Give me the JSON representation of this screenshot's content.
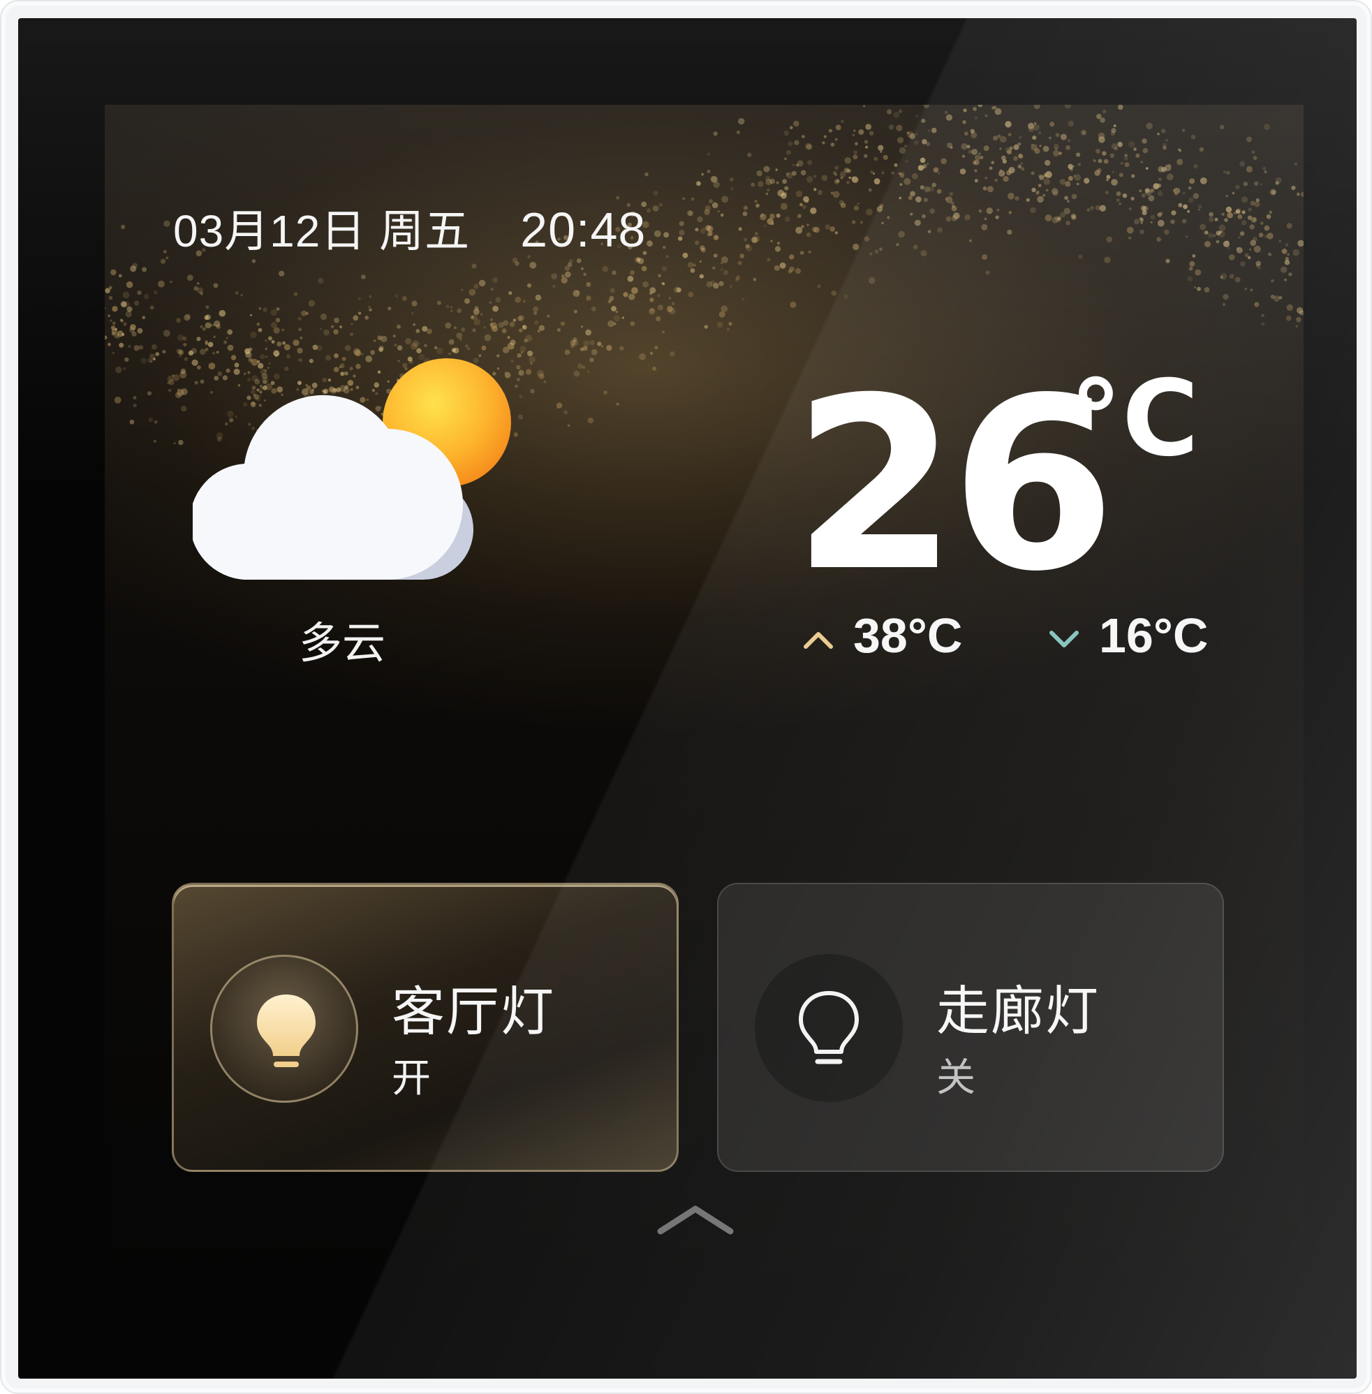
{
  "header": {
    "date": "03月12日 周五",
    "time": "20:48"
  },
  "weather": {
    "icon": "partly-cloudy-icon",
    "condition": "多云",
    "temperature": "26",
    "unit": "°C",
    "high": "38°C",
    "low": "16°C",
    "high_icon": "chevron-up-icon",
    "low_icon": "chevron-down-icon",
    "colors": {
      "high_chevron": "#e8c98a",
      "low_chevron": "#7fc0b8",
      "sun": "#f7a21e",
      "cloud": "#f6f8fb"
    }
  },
  "devices": [
    {
      "name": "客厅灯",
      "state": "开",
      "on": true,
      "icon": "lightbulb-on-icon"
    },
    {
      "name": "走廊灯",
      "state": "关",
      "on": false,
      "icon": "lightbulb-outline-icon"
    }
  ],
  "footer": {
    "swipe_icon": "chevron-up-icon"
  }
}
